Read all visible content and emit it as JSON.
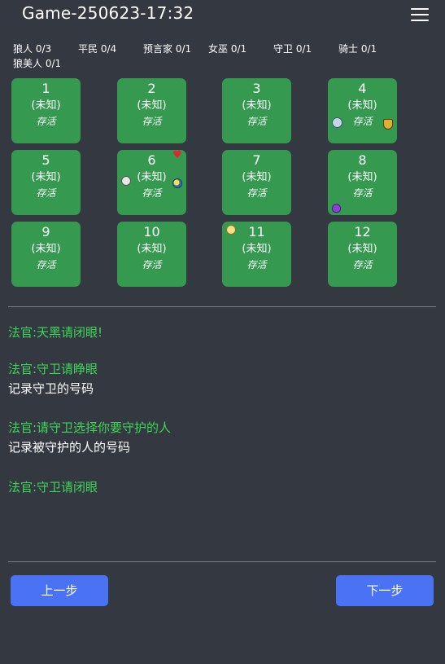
{
  "header": {
    "title": "Game-250623-17:32",
    "menu_icon": "hamburger-menu-icon"
  },
  "roles": [
    {
      "label": "狼人 0/3"
    },
    {
      "label": "平民 0/4"
    },
    {
      "label": "预言家 0/1"
    },
    {
      "label": "女巫 0/1"
    },
    {
      "label": "守卫 0/1"
    },
    {
      "label": "骑士 0/1"
    },
    {
      "label": "狼美人 0/1"
    }
  ],
  "players": [
    {
      "number": "1",
      "role": "(未知)",
      "status": "存活",
      "markers": []
    },
    {
      "number": "2",
      "role": "(未知)",
      "status": "存活",
      "markers": []
    },
    {
      "number": "3",
      "role": "(未知)",
      "status": "存活",
      "markers": []
    },
    {
      "number": "4",
      "role": "(未知)",
      "status": "存活",
      "markers": [
        "scared-face-icon",
        "shield-icon"
      ]
    },
    {
      "number": "5",
      "role": "(未知)",
      "status": "存活",
      "markers": []
    },
    {
      "number": "6",
      "role": "(未知)",
      "status": "存活",
      "markers": [
        "heart-icon",
        "skull-icon",
        "crystal-ball-icon"
      ]
    },
    {
      "number": "7",
      "role": "(未知)",
      "status": "存活",
      "markers": []
    },
    {
      "number": "8",
      "role": "(未知)",
      "status": "存活",
      "markers": [
        "potion-icon"
      ]
    },
    {
      "number": "9",
      "role": "(未知)",
      "status": "存活",
      "markers": []
    },
    {
      "number": "10",
      "role": "(未知)",
      "status": "存活",
      "markers": []
    },
    {
      "number": "11",
      "role": "(未知)",
      "status": "存活",
      "markers": [
        "dizzy-face-icon"
      ]
    },
    {
      "number": "12",
      "role": "(未知)",
      "status": "存活",
      "markers": []
    }
  ],
  "log": [
    {
      "type": "judge",
      "text": "法官:天黑请闭眼!"
    },
    {
      "type": "judge",
      "text": "法官:守卫请睁眼"
    },
    {
      "type": "note",
      "text": "记录守卫的号码"
    },
    {
      "type": "judge",
      "text": "法官:请守卫选择你要守护的人"
    },
    {
      "type": "note",
      "text": "记录被守护的人的号码"
    },
    {
      "type": "judge",
      "text": "法官:守卫请闭眼"
    }
  ],
  "buttons": {
    "prev": "上一步",
    "next": "下一步"
  },
  "colors": {
    "background": "#343841",
    "card": "#359a50",
    "judge_text": "#3dd659",
    "button": "#4a72f5"
  }
}
